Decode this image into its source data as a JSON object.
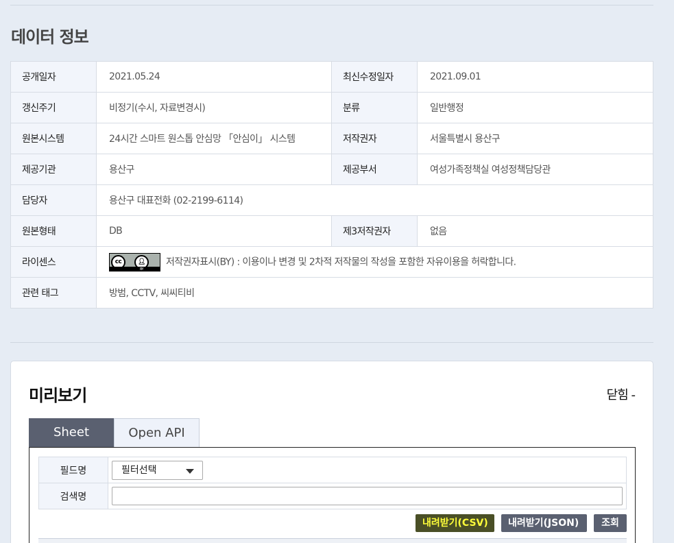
{
  "section": {
    "title": "데이터 정보"
  },
  "info": {
    "rows": [
      {
        "l1": "공개일자",
        "v1": "2021.05.24",
        "l2": "최신수정일자",
        "v2": "2021.09.01"
      },
      {
        "l1": "갱신주기",
        "v1": "비정기(수시, 자료변경시)",
        "l2": "분류",
        "v2": "일반행정"
      },
      {
        "l1": "원본시스템",
        "v1": "24시간 스마트 원스톱 안심망 「안심이」 시스템",
        "l2": "저작권자",
        "v2": "서울특별시 용산구"
      },
      {
        "l1": "제공기관",
        "v1": "용산구",
        "l2": "제공부서",
        "v2": "여성가족정책실 여성정책담당관"
      },
      {
        "l1": "담당자",
        "v1": "용산구 대표전화 (02-2199-6114)"
      },
      {
        "l1": "원본형태",
        "v1": "DB",
        "l2": "제3저작권자",
        "v2": "없음"
      },
      {
        "l1": "라이센스",
        "v1": "저작권자표시(BY) : 이용이나 변경 및 2차적 저작물의 작성을 포함한 자유이용을 허락합니다."
      },
      {
        "l1": "관련 태그",
        "v1": "방범, CCTV, 씨씨티비"
      }
    ],
    "license_badge": {
      "cc": "cc",
      "by": "BY"
    }
  },
  "preview": {
    "title": "미리보기",
    "close_label": "닫힘 -",
    "tabs": [
      {
        "label": "Sheet"
      },
      {
        "label": "Open API"
      }
    ],
    "filter": {
      "field_label": "필드명",
      "field_selected": "필터선택",
      "search_label": "검색명",
      "search_value": ""
    },
    "buttons": {
      "csv": "내려받기(CSV)",
      "json": "내려받기(JSON)",
      "query": "조회"
    }
  },
  "colors": {
    "page_bg": "#e6ecf4",
    "tab_active": "#5a6070",
    "csv_highlight": "#ffff3a"
  }
}
